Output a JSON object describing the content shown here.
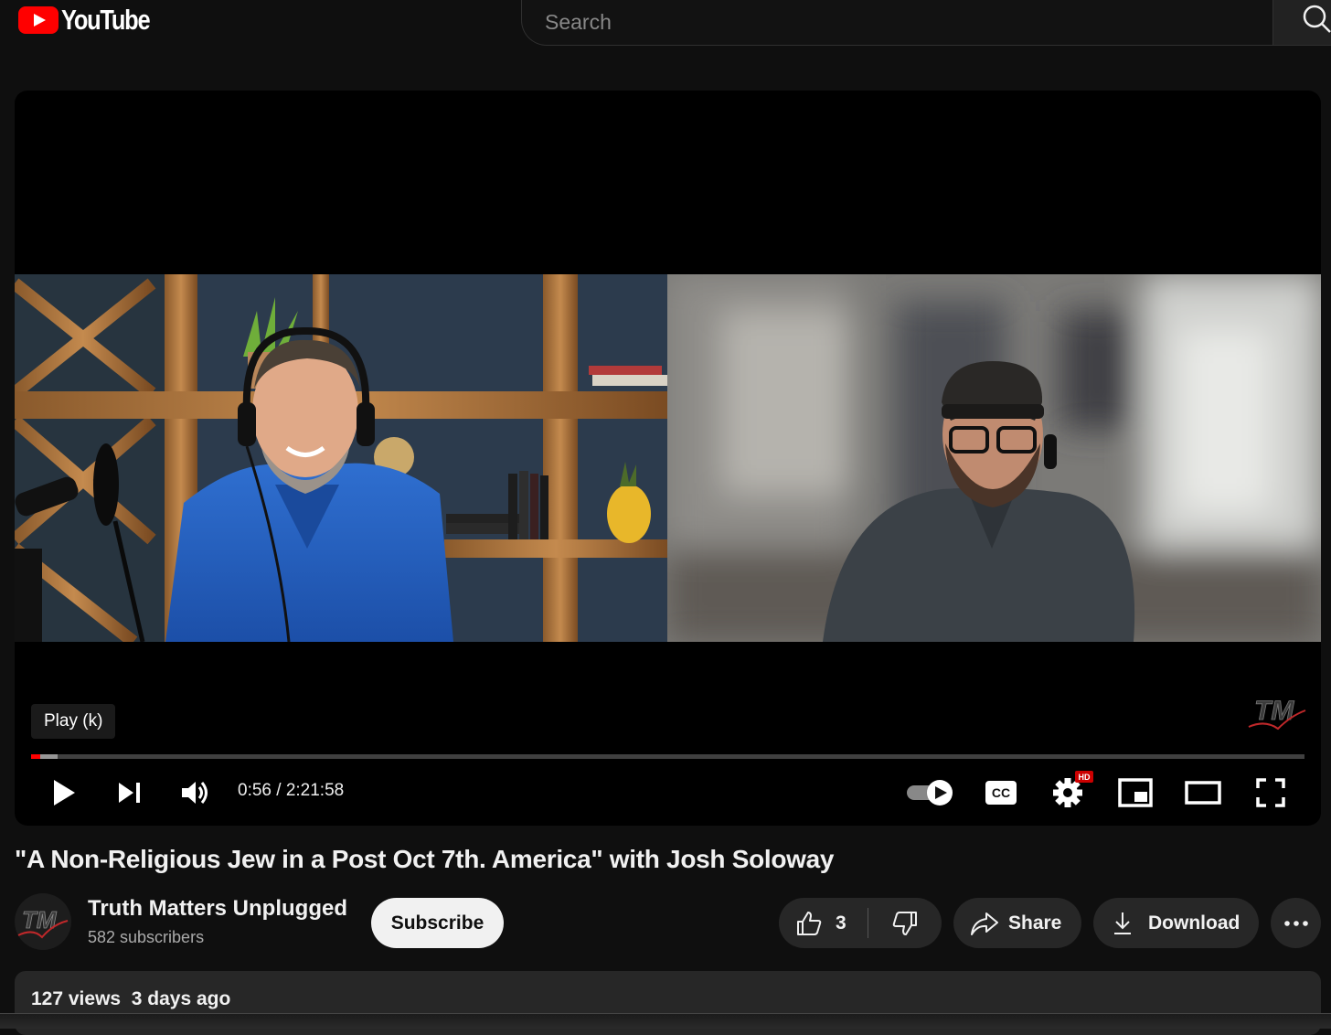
{
  "header": {
    "logo_text": "YouTube",
    "search_placeholder": "Search"
  },
  "player": {
    "tooltip": "Play (k)",
    "time_current": "0:56",
    "time_total": "2:21:58",
    "time_display": "0:56 / 2:21:58",
    "progress_played_fraction": 0.007,
    "progress_loaded_fraction": 0.021,
    "settings_badge": "HD",
    "captions_label": "CC",
    "watermark_text": "TM",
    "autoplay_on": true
  },
  "video": {
    "title": "\"A Non-Religious Jew in a Post Oct 7th. America\" with Josh Soloway"
  },
  "channel": {
    "name": "Truth Matters Unplugged",
    "subscribers": "582 subscribers",
    "avatar_text": "TM"
  },
  "actions": {
    "subscribe_label": "Subscribe",
    "like_count": "3",
    "share_label": "Share",
    "download_label": "Download"
  },
  "description": {
    "stats": "127 views  3 days ago"
  },
  "colors": {
    "background": "#0f0f0f",
    "accent_red": "#ff0000",
    "pill_bg": "#272727",
    "subscribe_bg": "#f1f1f1"
  }
}
